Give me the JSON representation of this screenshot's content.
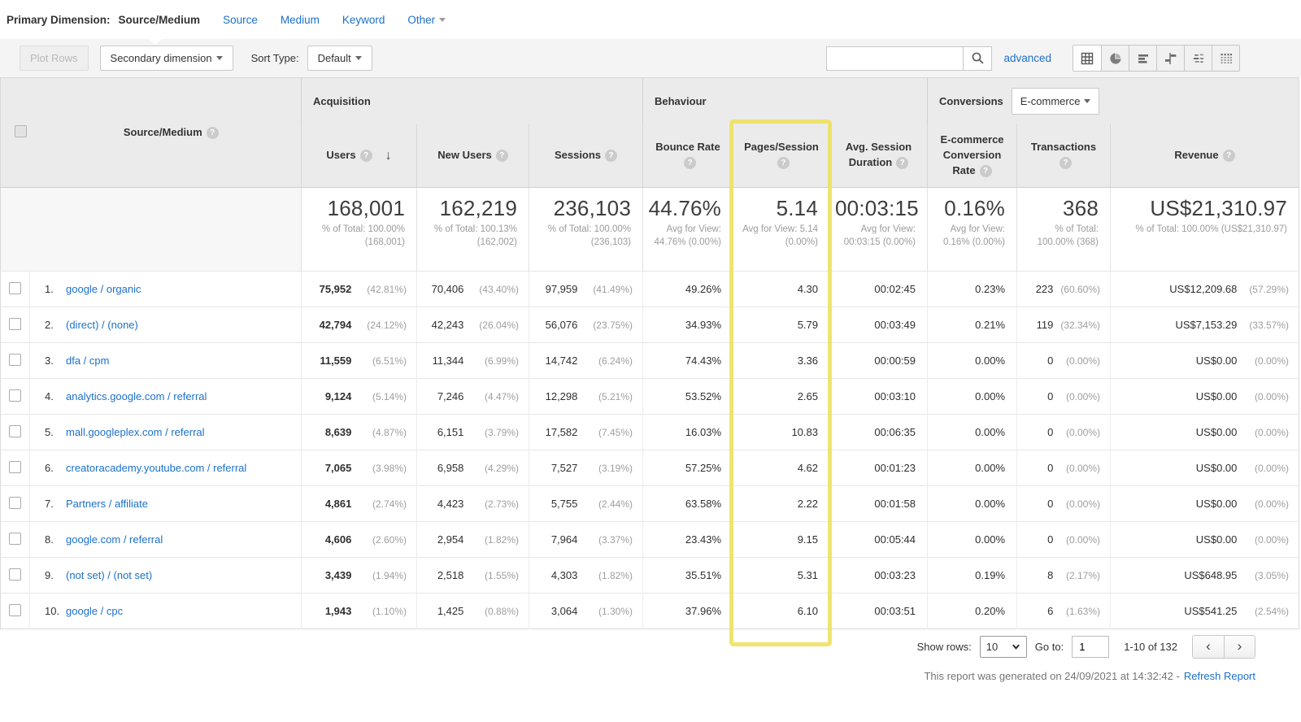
{
  "colors": {
    "link_blue": "#1c70c9",
    "highlight_yellow": "#eee15f",
    "header_gray": "#ebebeb"
  },
  "primary_dimension_bar": {
    "label": "Primary Dimension:",
    "selected": "Source/Medium",
    "links": [
      "Source",
      "Medium",
      "Keyword"
    ],
    "other_label": "Other"
  },
  "toolbar": {
    "plot_rows": "Plot Rows",
    "secondary_dimension": "Secondary dimension",
    "sort_type_label": "Sort Type:",
    "sort_type_value": "Default",
    "search_value": "",
    "advanced": "advanced",
    "view_icons": [
      "table-view",
      "percentage-view",
      "performance-view",
      "comparison-view",
      "term-cloud-view",
      "pivot-view"
    ]
  },
  "table": {
    "dimension_header": "Source/Medium",
    "groups": {
      "acquisition": "Acquisition",
      "behaviour": "Behaviour",
      "conversions": "Conversions",
      "conversions_selector": "E-commerce"
    },
    "col_headers": {
      "users": "Users",
      "new_users": "New Users",
      "sessions": "Sessions",
      "bounce": "Bounce Rate",
      "pages": "Pages/Session",
      "duration": "Avg. Session Duration",
      "conv": "E-commerce Conversion Rate",
      "trans": "Transactions",
      "revenue": "Revenue"
    },
    "summary": {
      "users": "168,001",
      "users_sub": "% of Total: 100.00% (168,001)",
      "new_users": "162,219",
      "new_users_sub": "% of Total: 100.13% (162,002)",
      "sessions": "236,103",
      "sessions_sub": "% of Total: 100.00% (236,103)",
      "bounce": "44.76%",
      "bounce_sub": "Avg for View: 44.76% (0.00%)",
      "pages": "5.14",
      "pages_sub": "Avg for View: 5.14 (0.00%)",
      "duration": "00:03:15",
      "duration_sub": "Avg for View: 00:03:15 (0.00%)",
      "conv": "0.16%",
      "conv_sub": "Avg for View: 0.16% (0.00%)",
      "trans": "368",
      "trans_sub": "% of Total: 100.00% (368)",
      "revenue": "US$21,310.97",
      "revenue_sub": "% of Total: 100.00% (US$21,310.97)"
    },
    "rows": [
      {
        "index": "1.",
        "source": "google / organic",
        "users": "75,952",
        "users_pct": "(42.81%)",
        "new_users": "70,406",
        "new_users_pct": "(43.40%)",
        "sessions": "97,959",
        "sessions_pct": "(41.49%)",
        "bounce": "49.26%",
        "pages": "4.30",
        "duration": "00:02:45",
        "conv": "0.23%",
        "trans": "223",
        "trans_pct": "(60.60%)",
        "revenue": "US$12,209.68",
        "revenue_pct": "(57.29%)"
      },
      {
        "index": "2.",
        "source": "(direct) / (none)",
        "users": "42,794",
        "users_pct": "(24.12%)",
        "new_users": "42,243",
        "new_users_pct": "(26.04%)",
        "sessions": "56,076",
        "sessions_pct": "(23.75%)",
        "bounce": "34.93%",
        "pages": "5.79",
        "duration": "00:03:49",
        "conv": "0.21%",
        "trans": "119",
        "trans_pct": "(32.34%)",
        "revenue": "US$7,153.29",
        "revenue_pct": "(33.57%)"
      },
      {
        "index": "3.",
        "source": "dfa / cpm",
        "users": "11,559",
        "users_pct": "(6.51%)",
        "new_users": "11,344",
        "new_users_pct": "(6.99%)",
        "sessions": "14,742",
        "sessions_pct": "(6.24%)",
        "bounce": "74.43%",
        "pages": "3.36",
        "duration": "00:00:59",
        "conv": "0.00%",
        "trans": "0",
        "trans_pct": "(0.00%)",
        "revenue": "US$0.00",
        "revenue_pct": "(0.00%)"
      },
      {
        "index": "4.",
        "source": "analytics.google.com / referral",
        "users": "9,124",
        "users_pct": "(5.14%)",
        "new_users": "7,246",
        "new_users_pct": "(4.47%)",
        "sessions": "12,298",
        "sessions_pct": "(5.21%)",
        "bounce": "53.52%",
        "pages": "2.65",
        "duration": "00:03:10",
        "conv": "0.00%",
        "trans": "0",
        "trans_pct": "(0.00%)",
        "revenue": "US$0.00",
        "revenue_pct": "(0.00%)"
      },
      {
        "index": "5.",
        "source": "mall.googleplex.com / referral",
        "users": "8,639",
        "users_pct": "(4.87%)",
        "new_users": "6,151",
        "new_users_pct": "(3.79%)",
        "sessions": "17,582",
        "sessions_pct": "(7.45%)",
        "bounce": "16.03%",
        "pages": "10.83",
        "duration": "00:06:35",
        "conv": "0.00%",
        "trans": "0",
        "trans_pct": "(0.00%)",
        "revenue": "US$0.00",
        "revenue_pct": "(0.00%)"
      },
      {
        "index": "6.",
        "source": "creatoracademy.youtube.com / referral",
        "users": "7,065",
        "users_pct": "(3.98%)",
        "new_users": "6,958",
        "new_users_pct": "(4.29%)",
        "sessions": "7,527",
        "sessions_pct": "(3.19%)",
        "bounce": "57.25%",
        "pages": "4.62",
        "duration": "00:01:23",
        "conv": "0.00%",
        "trans": "0",
        "trans_pct": "(0.00%)",
        "revenue": "US$0.00",
        "revenue_pct": "(0.00%)"
      },
      {
        "index": "7.",
        "source": "Partners / affiliate",
        "users": "4,861",
        "users_pct": "(2.74%)",
        "new_users": "4,423",
        "new_users_pct": "(2.73%)",
        "sessions": "5,755",
        "sessions_pct": "(2.44%)",
        "bounce": "63.58%",
        "pages": "2.22",
        "duration": "00:01:58",
        "conv": "0.00%",
        "trans": "0",
        "trans_pct": "(0.00%)",
        "revenue": "US$0.00",
        "revenue_pct": "(0.00%)"
      },
      {
        "index": "8.",
        "source": "google.com / referral",
        "users": "4,606",
        "users_pct": "(2.60%)",
        "new_users": "2,954",
        "new_users_pct": "(1.82%)",
        "sessions": "7,964",
        "sessions_pct": "(3.37%)",
        "bounce": "23.43%",
        "pages": "9.15",
        "duration": "00:05:44",
        "conv": "0.00%",
        "trans": "0",
        "trans_pct": "(0.00%)",
        "revenue": "US$0.00",
        "revenue_pct": "(0.00%)"
      },
      {
        "index": "9.",
        "source": "(not set) / (not set)",
        "users": "3,439",
        "users_pct": "(1.94%)",
        "new_users": "2,518",
        "new_users_pct": "(1.55%)",
        "sessions": "4,303",
        "sessions_pct": "(1.82%)",
        "bounce": "35.51%",
        "pages": "5.31",
        "duration": "00:03:23",
        "conv": "0.19%",
        "trans": "8",
        "trans_pct": "(2.17%)",
        "revenue": "US$648.95",
        "revenue_pct": "(3.05%)"
      },
      {
        "index": "10.",
        "source": "google / cpc",
        "users": "1,943",
        "users_pct": "(1.10%)",
        "new_users": "1,425",
        "new_users_pct": "(0.88%)",
        "sessions": "3,064",
        "sessions_pct": "(1.30%)",
        "bounce": "37.96%",
        "pages": "6.10",
        "duration": "00:03:51",
        "conv": "0.20%",
        "trans": "6",
        "trans_pct": "(1.63%)",
        "revenue": "US$541.25",
        "revenue_pct": "(2.54%)"
      }
    ]
  },
  "pagination": {
    "show_rows_label": "Show rows:",
    "show_rows_value": "10",
    "goto_label": "Go to:",
    "goto_value": "1",
    "range": "1-10 of 132"
  },
  "footer_note": {
    "text": "This report was generated on 24/09/2021 at 14:32:42 -",
    "link": "Refresh Report"
  }
}
